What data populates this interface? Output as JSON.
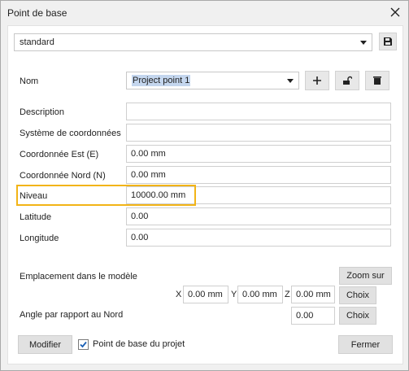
{
  "window": {
    "title": "Point de base"
  },
  "preset": {
    "value": "standard"
  },
  "nom": {
    "label": "Nom",
    "value": "Project point 1"
  },
  "fields": {
    "description": {
      "label": "Description",
      "value": ""
    },
    "systeme": {
      "label": "Système de coordonnées",
      "value": ""
    },
    "est": {
      "label": "Coordonnée Est  (E)",
      "value": "0.00 mm"
    },
    "nord": {
      "label": "Coordonnée Nord  (N)",
      "value": "0.00 mm"
    },
    "niveau": {
      "label": "Niveau",
      "value": "10000.00 mm"
    },
    "latitude": {
      "label": "Latitude",
      "value": "0.00"
    },
    "longitude": {
      "label": "Longitude",
      "value": "0.00"
    }
  },
  "emplacement": {
    "label": "Emplacement dans le modèle",
    "zoom_label": "Zoom sur",
    "x_label": "X",
    "x_value": "0.00 mm",
    "y_label": "Y",
    "y_value": "0.00 mm",
    "z_label": "Z",
    "z_value": "0.00 mm",
    "choix_label": "Choix"
  },
  "angle": {
    "label": "Angle par rapport au Nord",
    "value": "0.00",
    "choix_label": "Choix"
  },
  "footer": {
    "modifier_label": "Modifier",
    "checkbox_label": "Point de base du projet",
    "checkbox_checked": true,
    "fermer_label": "Fermer"
  },
  "colors": {
    "highlight": "#f2b417",
    "selection": "#c4d6ee"
  },
  "icons": [
    "close-icon",
    "chevron-down-icon",
    "save-icon",
    "plus-icon",
    "unlock-icon",
    "trash-icon",
    "checkmark-icon"
  ]
}
